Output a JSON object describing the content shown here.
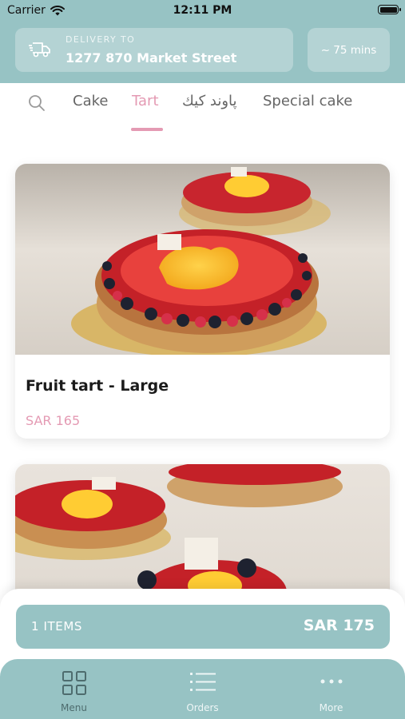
{
  "status_bar": {
    "carrier": "Carrier",
    "time": "12:11 PM"
  },
  "header": {
    "delivery_label": "DELIVERY TO",
    "delivery_address": "1277 870 Market Street",
    "eta": "~ 75 mins"
  },
  "tabs": [
    {
      "label": "Cake",
      "active": false
    },
    {
      "label": "Tart",
      "active": true
    },
    {
      "label": "پاوند كيك",
      "active": false
    },
    {
      "label": "Special cake",
      "active": false
    }
  ],
  "products": [
    {
      "name": "Fruit tart - Large",
      "price": "SAR 165"
    },
    {
      "name": "",
      "price": ""
    }
  ],
  "cart": {
    "items_label": "1 ITEMS",
    "total": "SAR 175"
  },
  "bottom_nav": [
    {
      "label": "Menu",
      "icon": "grid-icon",
      "active": true
    },
    {
      "label": "Orders",
      "icon": "list-icon",
      "active": false
    },
    {
      "label": "More",
      "icon": "more-dots-icon",
      "active": false
    }
  ],
  "colors": {
    "accent_teal": "#97c3c4",
    "accent_pink": "#e49ab3"
  }
}
